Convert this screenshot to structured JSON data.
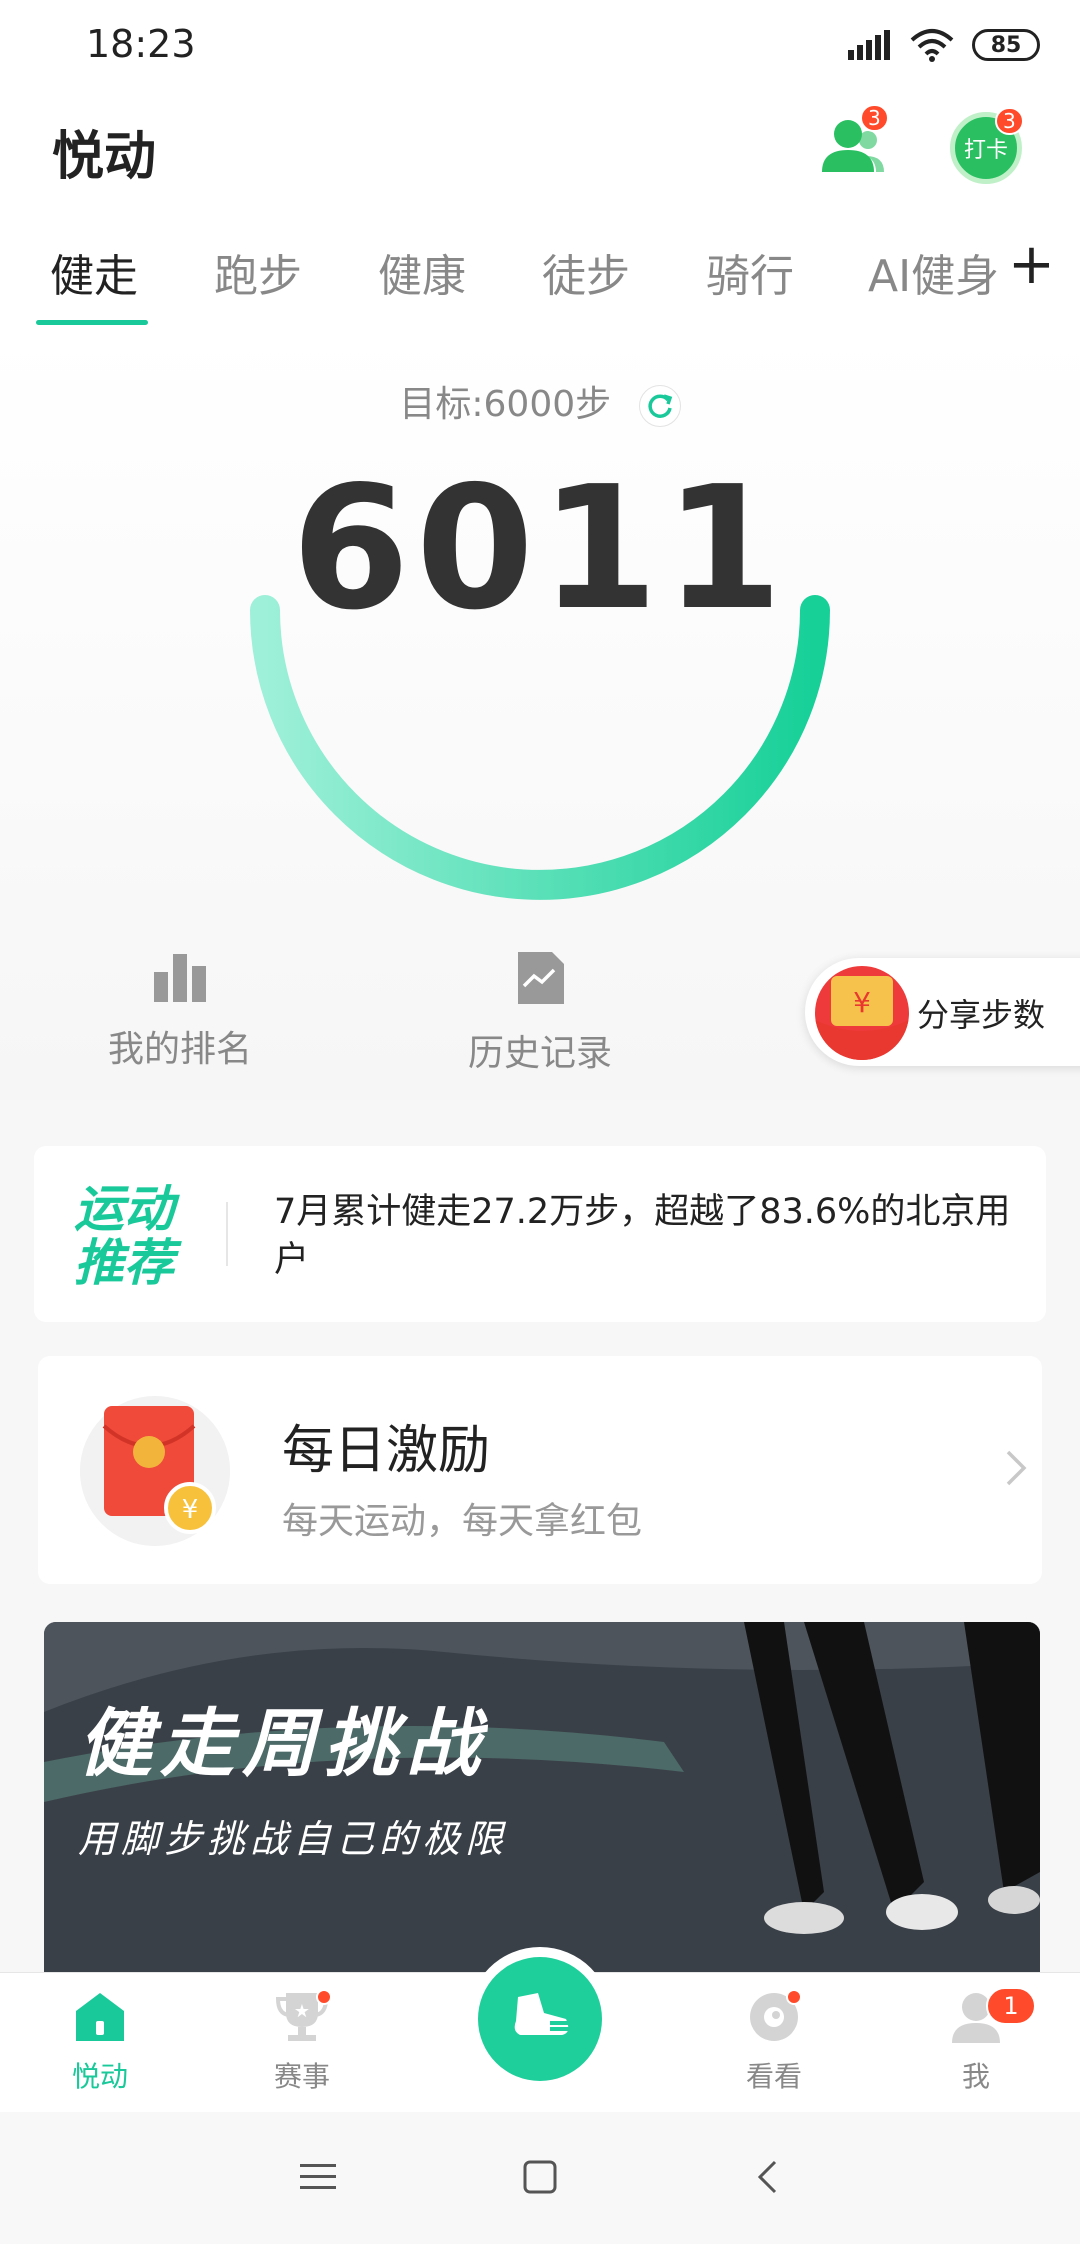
{
  "status_bar": {
    "time": "18:23",
    "battery": "85"
  },
  "header": {
    "title": "悦动",
    "friends_badge": "3",
    "checkin_label": "打卡",
    "checkin_badge": "3"
  },
  "tabs": [
    {
      "label": "健走"
    },
    {
      "label": "跑步"
    },
    {
      "label": "健康"
    },
    {
      "label": "徒步"
    },
    {
      "label": "骑行"
    },
    {
      "label": "AI健身"
    }
  ],
  "steps": {
    "goal": "目标:6000步",
    "count": "6011"
  },
  "shortcuts": {
    "ranking": "我的排名",
    "history": "历史记录",
    "share": "分享步数"
  },
  "recommendation": {
    "title": "运动推荐",
    "text": "7月累计健走27.2万步，超越了83.6%的北京用户"
  },
  "daily": {
    "title": "每日激励",
    "subtitle": "每天运动，每天拿红包"
  },
  "banner": {
    "title": "健走周挑战",
    "subtitle": "用脚步挑战自己的极限"
  },
  "bottom_nav": {
    "items": [
      {
        "label": "悦动"
      },
      {
        "label": "赛事"
      },
      {
        "label": "看看"
      },
      {
        "label": "我",
        "badge": "1"
      }
    ]
  },
  "colors": {
    "accent": "#19c99a",
    "badge": "#ff4b2b",
    "checkin": "#2ac062"
  }
}
